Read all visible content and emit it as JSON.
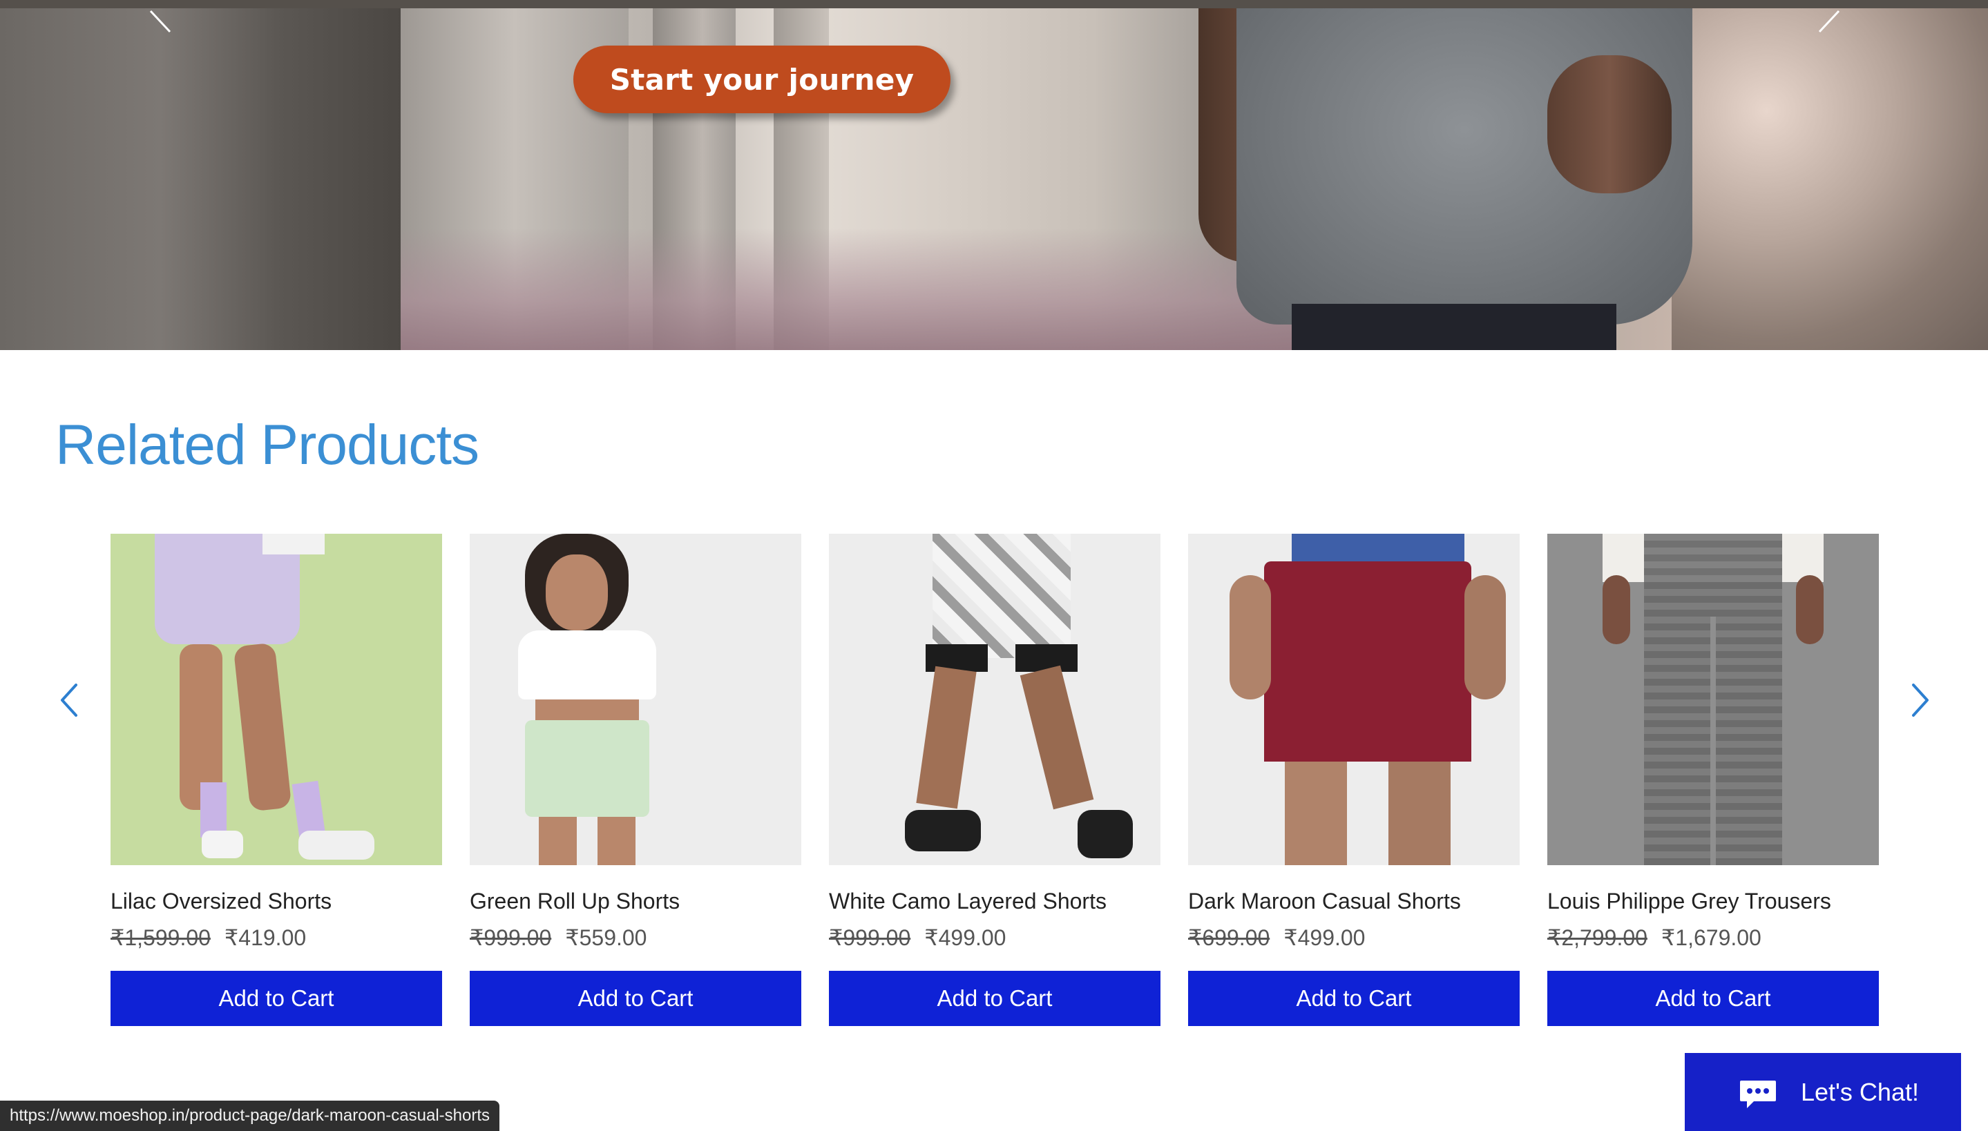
{
  "hero": {
    "cta_label": "Start your journey"
  },
  "related": {
    "title": "Related Products",
    "add_to_cart_label": "Add to Cart",
    "products": [
      {
        "name": "Lilac Oversized Shorts",
        "old_price": "₹1,599.00",
        "price": "₹419.00"
      },
      {
        "name": "Green Roll Up Shorts",
        "old_price": "₹999.00",
        "price": "₹559.00"
      },
      {
        "name": "White Camo Layered Shorts",
        "old_price": "₹999.00",
        "price": "₹499.00"
      },
      {
        "name": "Dark Maroon Casual Shorts",
        "old_price": "₹699.00",
        "price": "₹499.00"
      },
      {
        "name": "Louis Philippe Grey Trousers",
        "old_price": "₹2,799.00",
        "price": "₹1,679.00"
      }
    ]
  },
  "status_bar": {
    "url": "https://www.moeshop.in/product-page/dark-maroon-casual-shorts"
  },
  "chat": {
    "label": "Let's Chat!"
  },
  "colors": {
    "accent_blue": "#3b8fd4",
    "button_blue": "#0f22d6",
    "cta_orange": "#bf4b1e",
    "chat_blue": "#1621c8"
  }
}
